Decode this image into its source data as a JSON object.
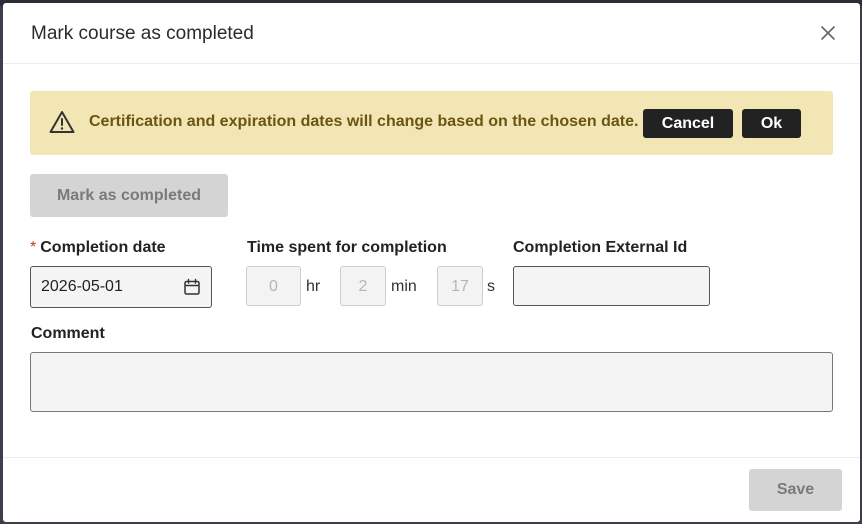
{
  "dialog": {
    "title": "Mark course as completed",
    "close_icon": "close-icon"
  },
  "banner": {
    "icon": "warning-icon",
    "message": "Certification and expiration dates will change based on the chosen date.",
    "cancel_label": "Cancel",
    "ok_label": "Ok",
    "background_color": "#f2e6b4",
    "text_color": "#6b5512"
  },
  "mark_completed_label": "Mark as completed",
  "form": {
    "completion_date": {
      "required_marker": "*",
      "label": "Completion date",
      "value": "2026-05-01",
      "icon": "calendar-icon"
    },
    "time_spent": {
      "label": "Time spent for completion",
      "hours": "0",
      "hours_unit": "hr",
      "minutes": "2",
      "minutes_unit": "min",
      "seconds": "17",
      "seconds_unit": "s"
    },
    "external_id": {
      "label": "Completion External Id",
      "value": ""
    },
    "comment": {
      "label": "Comment",
      "value": ""
    }
  },
  "footer": {
    "save_label": "Save"
  }
}
